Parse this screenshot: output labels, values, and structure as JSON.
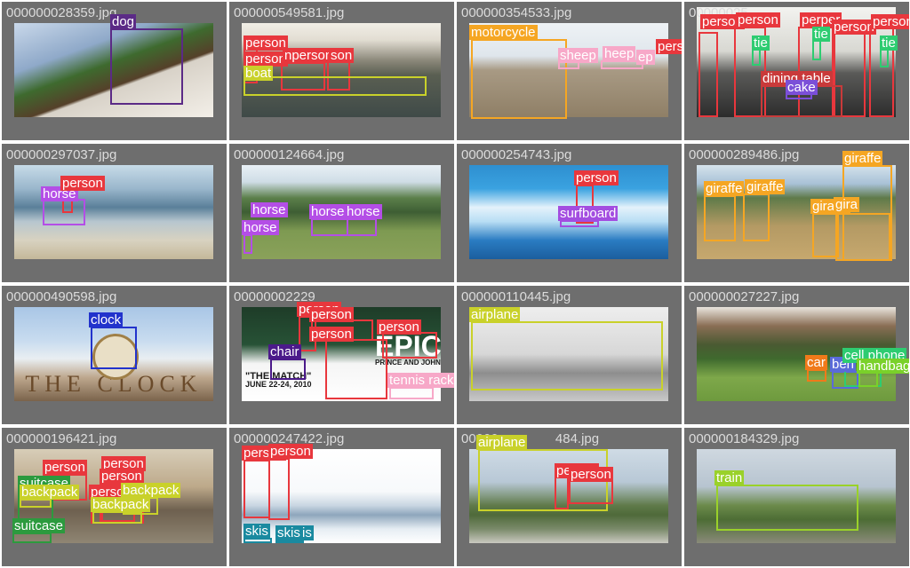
{
  "colors": {
    "person": "#e8373d",
    "dog": "#5b2a86",
    "horse": "#b44ee6",
    "giraffe": "#f5a623",
    "motorcycle": "#f5a623",
    "sheep": "#f7a8c8",
    "cake": "#7b4fd8",
    "tie": "#2ecc71",
    "surfboard": "#a34de0",
    "clock": "#2233cc",
    "chair": "#4b1a8a",
    "tennis racket": "#f7a8c8",
    "airplane": "#c9d12a",
    "car": "#f07a1a",
    "bench": "#5a6bd8",
    "cell phone": "#2ecc71",
    "handbag": "#7ad12a",
    "suitcase": "#2c9a3e",
    "backpack": "#c9d12a",
    "skis": "#1a8aa0",
    "train": "#9ad12a",
    "boat": "#c9d12a",
    "dining table": "#c93a3a"
  },
  "cells": [
    {
      "filename": "000000028359.jpg",
      "scene": "mirror-dog",
      "labels": [
        {
          "text": "dog",
          "class": "dog"
        }
      ]
    },
    {
      "filename": "000000549581.jpg",
      "scene": "boat-people",
      "labels": [
        {
          "text": "person",
          "class": "person"
        },
        {
          "text": "person",
          "class": "person"
        },
        {
          "text": "nperson",
          "class": "person"
        },
        {
          "text": "son",
          "class": "person"
        },
        {
          "text": "boat",
          "class": "boat"
        }
      ]
    },
    {
      "filename": "000000354533.jpg",
      "scene": "motorcycle-sheep",
      "labels": [
        {
          "text": "motorcycle",
          "class": "motorcycle"
        },
        {
          "text": "sheep",
          "class": "sheep"
        },
        {
          "text": "heep",
          "class": "sheep"
        },
        {
          "text": "ep",
          "class": "sheep"
        },
        {
          "text": "pers",
          "class": "person"
        }
      ]
    },
    {
      "filename": "00000025",
      "scene": "wedding",
      "labels": [
        {
          "text": "person",
          "class": "person"
        },
        {
          "text": "person",
          "class": "person"
        },
        {
          "text": "perper",
          "class": "person"
        },
        {
          "text": "person",
          "class": "person"
        },
        {
          "text": "person",
          "class": "person"
        },
        {
          "text": "tie",
          "class": "tie"
        },
        {
          "text": "tie",
          "class": "tie"
        },
        {
          "text": "tie",
          "class": "tie"
        },
        {
          "text": "dining table",
          "class": "dining table"
        },
        {
          "text": "cake",
          "class": "cake"
        }
      ]
    },
    {
      "filename": "000000297037.jpg",
      "scene": "horse-beach",
      "labels": [
        {
          "text": "horse",
          "class": "horse"
        },
        {
          "text": "person",
          "class": "person"
        }
      ]
    },
    {
      "filename": "000000124664.jpg",
      "scene": "horses-field",
      "labels": [
        {
          "text": "horse",
          "class": "horse"
        },
        {
          "text": "horse",
          "class": "horse"
        },
        {
          "text": "horse",
          "class": "horse"
        },
        {
          "text": "horse",
          "class": "horse"
        }
      ]
    },
    {
      "filename": "000000254743.jpg",
      "scene": "surf",
      "labels": [
        {
          "text": "person",
          "class": "person"
        },
        {
          "text": "surfboard",
          "class": "surfboard"
        }
      ]
    },
    {
      "filename": "000000289486.jpg",
      "scene": "giraffes",
      "labels": [
        {
          "text": "giraffe",
          "class": "giraffe"
        },
        {
          "text": "giraffe",
          "class": "giraffe"
        },
        {
          "text": "giraffe",
          "class": "giraffe"
        },
        {
          "text": "gira",
          "class": "giraffe"
        },
        {
          "text": "giraffe",
          "class": "giraffe"
        }
      ]
    },
    {
      "filename": "000000490598.jpg",
      "scene": "clock-gate",
      "labels": [
        {
          "text": "clock",
          "class": "clock"
        }
      ],
      "sign_text": "THE CLOCK"
    },
    {
      "filename": "00000002229",
      "scene": "tennis",
      "labels": [
        {
          "text": "person",
          "class": "person"
        },
        {
          "text": "person",
          "class": "person"
        },
        {
          "text": "person",
          "class": "person"
        },
        {
          "text": "person",
          "class": "person"
        },
        {
          "text": "chair",
          "class": "chair"
        },
        {
          "text": "tennis racket",
          "class": "tennis racket"
        }
      ],
      "poster_text": [
        "EPIC",
        "PRINCE AND JOHN ISNER MAKE TENNIS HISTORY",
        "\"THE MATCH\"",
        "JUNE 22-24, 2010"
      ]
    },
    {
      "filename": "000000110445.jpg",
      "scene": "vintage-plane",
      "labels": [
        {
          "text": "airplane",
          "class": "airplane"
        }
      ]
    },
    {
      "filename": "000000027227.jpg",
      "scene": "park",
      "labels": [
        {
          "text": "car",
          "class": "car"
        },
        {
          "text": "ben",
          "class": "bench"
        },
        {
          "text": "cell phone",
          "class": "cell phone"
        },
        {
          "text": "handbag",
          "class": "handbag"
        }
      ]
    },
    {
      "filename": "000000196421.jpg",
      "scene": "luggage-room",
      "labels": [
        {
          "text": "person",
          "class": "person"
        },
        {
          "text": "person",
          "class": "person"
        },
        {
          "text": "person",
          "class": "person"
        },
        {
          "text": "person",
          "class": "person"
        },
        {
          "text": "suitcase",
          "class": "suitcase"
        },
        {
          "text": "backpack",
          "class": "backpack"
        },
        {
          "text": "backpack",
          "class": "backpack"
        },
        {
          "text": "backpack",
          "class": "backpack"
        },
        {
          "text": "suitcase",
          "class": "suitcase"
        }
      ]
    },
    {
      "filename": "000000247422.jpg",
      "scene": "ski-mountain",
      "labels": [
        {
          "text": "person",
          "class": "person"
        },
        {
          "text": "person",
          "class": "person"
        },
        {
          "text": "skis",
          "class": "skis"
        },
        {
          "text": "skis",
          "class": "skis"
        },
        {
          "text": "is",
          "class": "skis"
        }
      ]
    },
    {
      "filename": "00000",
      "filename_suffix": "484.jpg",
      "scene": "jet",
      "labels": [
        {
          "text": "airplane",
          "class": "airplane"
        },
        {
          "text": "person",
          "class": "person"
        },
        {
          "text": "person",
          "class": "person"
        }
      ]
    },
    {
      "filename": "000000184329.jpg",
      "scene": "train",
      "labels": [
        {
          "text": "train",
          "class": "train"
        }
      ]
    }
  ]
}
